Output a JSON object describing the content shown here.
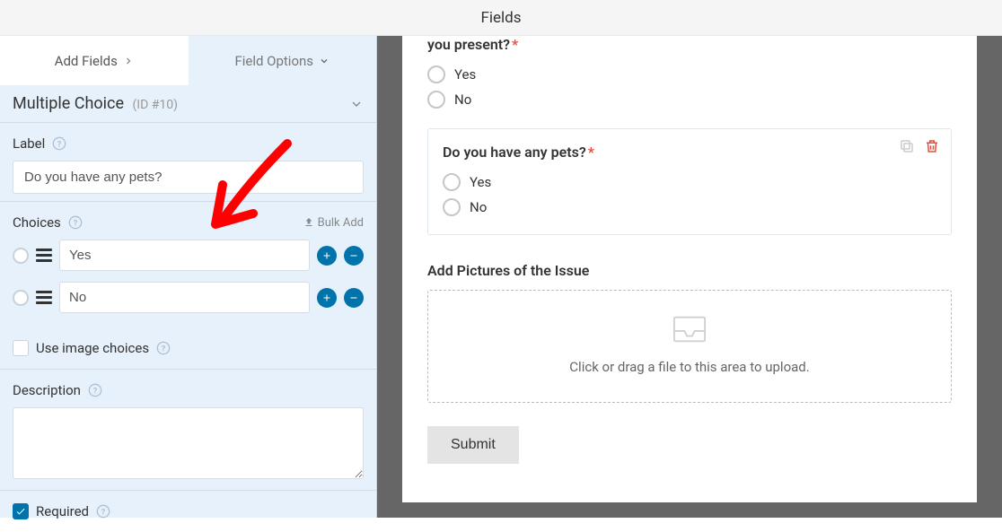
{
  "top_title": "Fields",
  "tabs": {
    "add_fields": "Add Fields",
    "field_options": "Field Options"
  },
  "section": {
    "title": "Multiple Choice",
    "id": "(ID #10)"
  },
  "labels": {
    "label": "Label",
    "choices": "Choices",
    "bulk_add": "Bulk Add",
    "use_image_choices": "Use image choices",
    "description": "Description",
    "required": "Required"
  },
  "field_options": {
    "label_value": "Do you have any pets?",
    "choices": [
      {
        "text": "Yes"
      },
      {
        "text": "No"
      }
    ],
    "description_value": "",
    "use_image_choices": false,
    "required": true
  },
  "preview": {
    "q1": {
      "title": "you present?",
      "opt1": "Yes",
      "opt2": "No"
    },
    "q2": {
      "title": "Do you have any pets?",
      "opt1": "Yes",
      "opt2": "No"
    },
    "upload_title": "Add Pictures of the Issue",
    "dropzone_text": "Click or drag a file to this area to upload.",
    "submit": "Submit"
  }
}
